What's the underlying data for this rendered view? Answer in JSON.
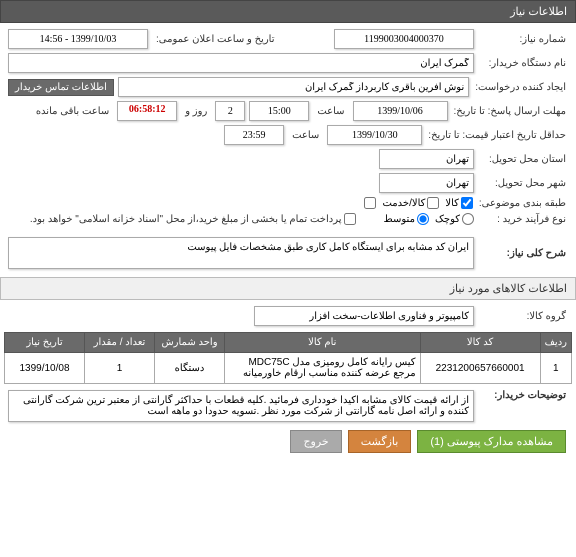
{
  "header": {
    "title": "اطلاعات نیاز"
  },
  "form": {
    "need_number_label": "شماره نیاز:",
    "need_number": "1199003004000370",
    "announce_label": "تاریخ و ساعت اعلان عمومی:",
    "announce_value": "1399/10/03 - 14:56",
    "creator_label": "نام دستگاه خریدار:",
    "creator": "گمرک ایران",
    "request_creator_label": "ایجاد کننده درخواست:",
    "request_creator": "نوش آفرین باقری کاربرداز گمرک ایران",
    "contact_btn": "اطلاعات تماس خریدار",
    "deadline_reply_label": "مهلت ارسال پاسخ: تا تاریخ:",
    "deadline_reply_date": "1399/10/06",
    "time_label": "ساعت",
    "deadline_reply_time": "15:00",
    "days_remain": "2",
    "days_label": "روز و",
    "timer": "06:58:12",
    "remain_label": "ساعت باقی مانده",
    "validity_label": "حداقل تاریخ اعتبار قیمت: تا تاریخ:",
    "validity_date": "1399/10/30",
    "validity_time": "23:59",
    "delivery_state_label": "استان محل تحویل:",
    "delivery_state": "تهران",
    "delivery_city_label": "شهر محل تحویل:",
    "delivery_city": "تهران",
    "category_label": "طبقه بندی موضوعی:",
    "cat_goods": "کالا",
    "cat_service": "کالا/خدمت",
    "cat_chk1": "",
    "process_label": "نوع فرآیند خرید :",
    "proc_small": "کوچک",
    "proc_medium": "متوسط",
    "pay_note": "پرداخت تمام یا بخشی از مبلغ خرید،از محل \"اسناد خزانه اسلامی\" خواهد بود."
  },
  "general_desc": {
    "label": "شرح کلی نیاز:",
    "value": "ایران کد مشابه برای ایستگاه کامل کاری طبق مشخصات فایل پیوست"
  },
  "items_section": {
    "header": "اطلاعات کالاهای مورد نیاز",
    "group_label": "گروه کالا:",
    "group_value": "کامپیوتر و فناوری اطلاعات-سخت افزار"
  },
  "table": {
    "headers": {
      "idx": "ردیف",
      "code": "کد کالا",
      "name": "نام کالا",
      "unit": "واحد شمارش",
      "qty": "تعداد / مقدار",
      "date": "تاریخ نیاز"
    },
    "rows": [
      {
        "idx": "1",
        "code": "2231200657660001",
        "name": "کیس رایانه کامل رومیزی مدل MDC75C مرجع عرضه کننده مناسب ارقام خاورمیانه",
        "unit": "دستگاه",
        "qty": "1",
        "date": "1399/10/08"
      }
    ]
  },
  "buyer_notes": {
    "label": "توضیحات خریدار:",
    "value": "از ارائه قیمت کالای مشابه اکیدا خودداری فرمائید .کلیه قطعات با حداکثر گارانتی از معتبر ترین شرکت گارانتی کننده و ارائه اصل نامه گارانتی از شرکت مورد نظر .تسویه حدودا دو ماهه است"
  },
  "buttons": {
    "attachments": "مشاهده مدارک پیوستی (1)",
    "back": "بازگشت",
    "exit": "خروج"
  }
}
